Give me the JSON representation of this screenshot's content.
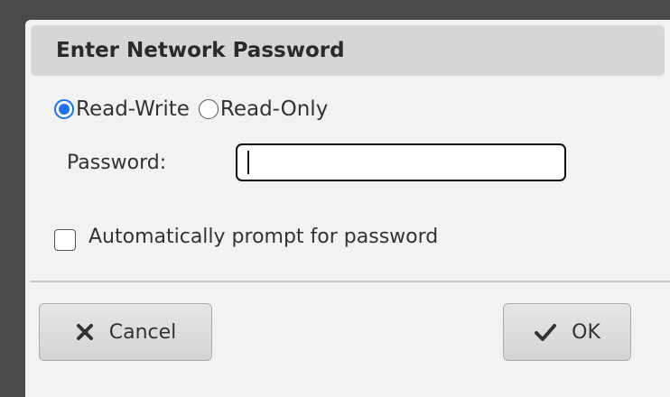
{
  "dialog": {
    "title": "Enter Network Password",
    "access_mode": {
      "options": [
        {
          "label": "Read-Write",
          "selected": true
        },
        {
          "label": "Read-Only",
          "selected": false
        }
      ]
    },
    "password": {
      "label": "Password:",
      "value": ""
    },
    "auto_prompt": {
      "label": "Automatically prompt for password",
      "checked": false
    },
    "buttons": {
      "cancel_label": "Cancel",
      "ok_label": "OK"
    }
  },
  "icons": {
    "cancel": "close-icon",
    "ok": "checkmark-icon"
  },
  "colors": {
    "accent": "#1a73e8",
    "dialog_bg": "#f2f2f2",
    "titlebar_bg": "#d6d6d6",
    "backdrop": "#4a4a4a"
  }
}
